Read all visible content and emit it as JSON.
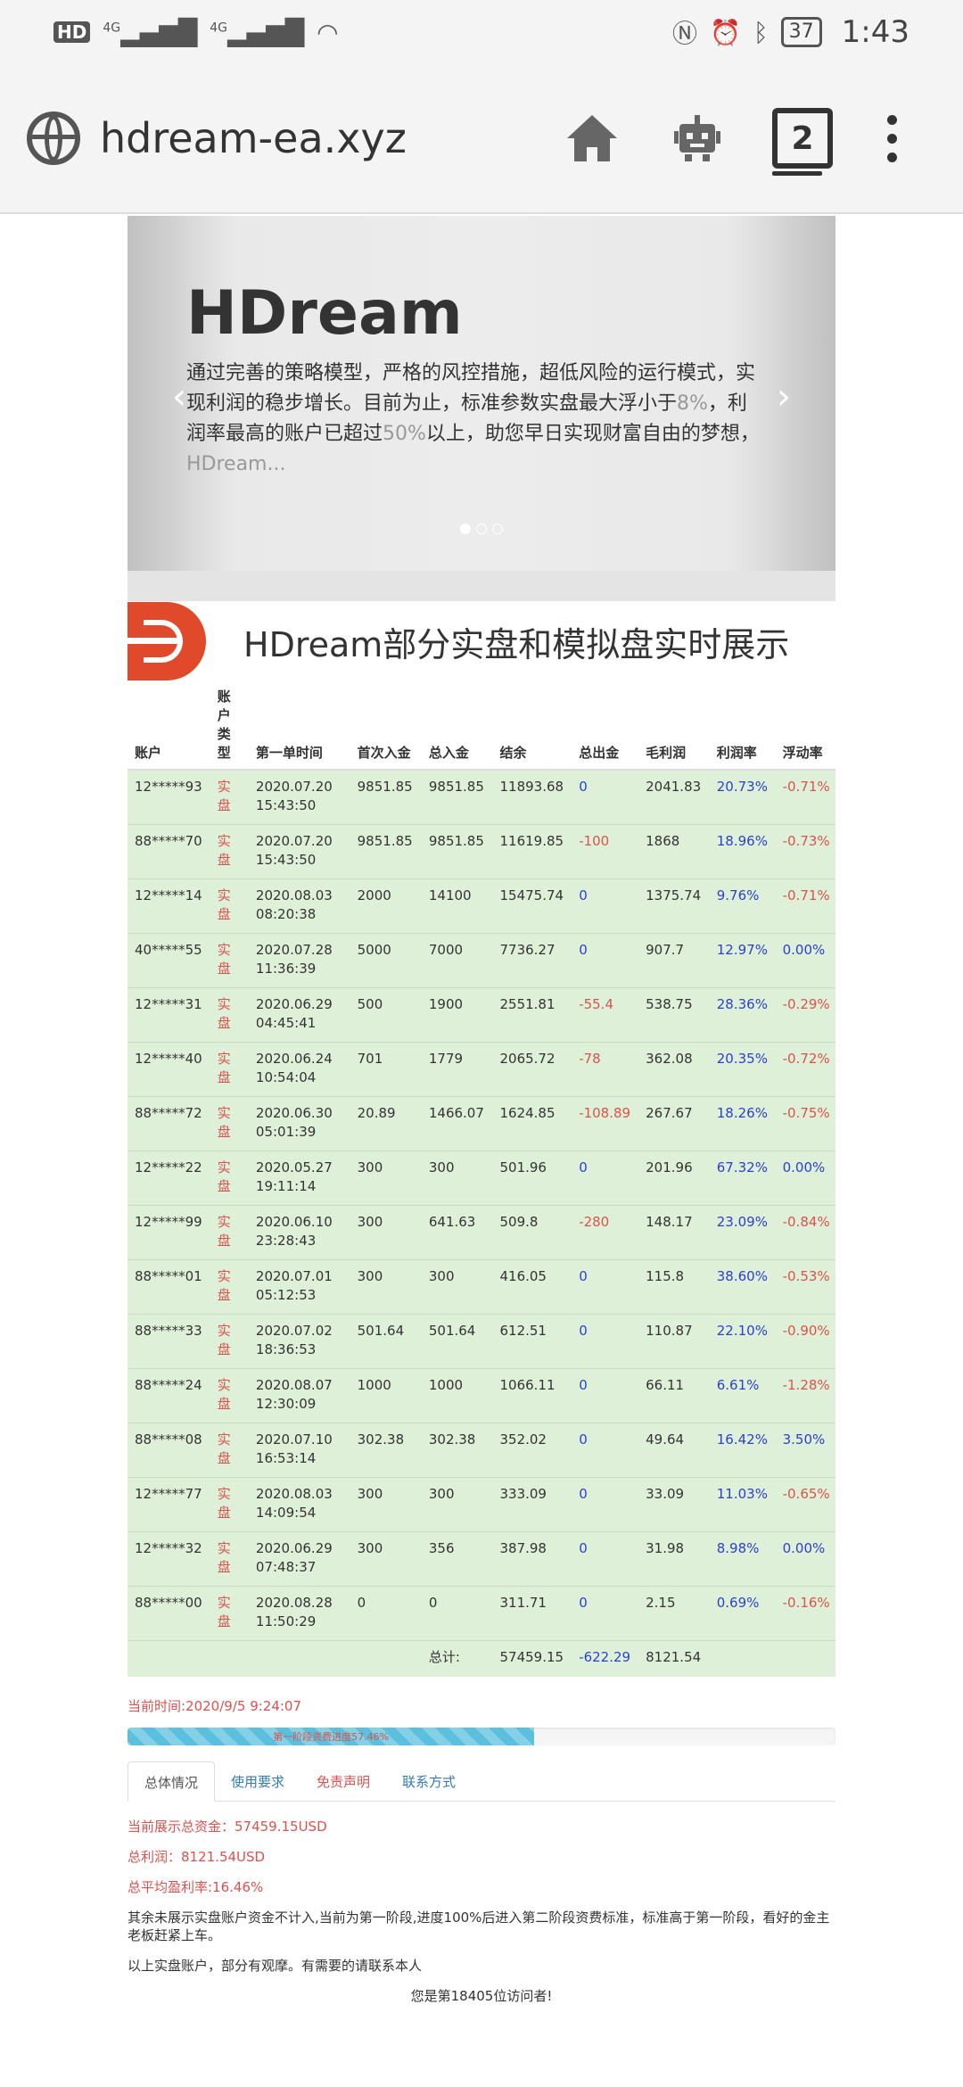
{
  "status_bar": {
    "hd": "HD",
    "net1": "4G",
    "net2": "4G",
    "battery": "37",
    "time": "1:43"
  },
  "browser": {
    "url": "hdream-ea.xyz",
    "tab_count": "2"
  },
  "carousel": {
    "title": "HDream",
    "desc_1": "通过完善的策略模型，严格的风控措施，超低风险的运行模式，实现利润的稳步增长。目前为止，标准参数实盘最大浮小于",
    "desc_hl1": "8%",
    "desc_2": "，利润率最高的账户已超过",
    "desc_hl2": "50%",
    "desc_3": "以上，助您早日实现财富自由的梦想，",
    "desc_more": "HDream...",
    "prev": "‹",
    "next": "›"
  },
  "heading": "HDream部分实盘和模拟盘实时展示",
  "table": {
    "headers": [
      "账户",
      "账户类型",
      "第一单时间",
      "首次入金",
      "总入金",
      "结余",
      "总出金",
      "毛利润",
      "利润率",
      "浮动率"
    ],
    "rows": [
      [
        "12*****93",
        "实盘",
        "2020.07.20 15:43:50",
        "9851.85",
        "9851.85",
        "11893.68",
        "0",
        "2041.83",
        "20.73%",
        "-0.71%"
      ],
      [
        "88*****70",
        "实盘",
        "2020.07.20 15:43:50",
        "9851.85",
        "9851.85",
        "11619.85",
        "-100",
        "1868",
        "18.96%",
        "-0.73%"
      ],
      [
        "12*****14",
        "实盘",
        "2020.08.03 08:20:38",
        "2000",
        "14100",
        "15475.74",
        "0",
        "1375.74",
        "9.76%",
        "-0.71%"
      ],
      [
        "40*****55",
        "实盘",
        "2020.07.28 11:36:39",
        "5000",
        "7000",
        "7736.27",
        "0",
        "907.7",
        "12.97%",
        "0.00%"
      ],
      [
        "12*****31",
        "实盘",
        "2020.06.29 04:45:41",
        "500",
        "1900",
        "2551.81",
        "-55.4",
        "538.75",
        "28.36%",
        "-0.29%"
      ],
      [
        "12*****40",
        "实盘",
        "2020.06.24 10:54:04",
        "701",
        "1779",
        "2065.72",
        "-78",
        "362.08",
        "20.35%",
        "-0.72%"
      ],
      [
        "88*****72",
        "实盘",
        "2020.06.30 05:01:39",
        "20.89",
        "1466.07",
        "1624.85",
        "-108.89",
        "267.67",
        "18.26%",
        "-0.75%"
      ],
      [
        "12*****22",
        "实盘",
        "2020.05.27 19:11:14",
        "300",
        "300",
        "501.96",
        "0",
        "201.96",
        "67.32%",
        "0.00%"
      ],
      [
        "12*****99",
        "实盘",
        "2020.06.10 23:28:43",
        "300",
        "641.63",
        "509.8",
        "-280",
        "148.17",
        "23.09%",
        "-0.84%"
      ],
      [
        "88*****01",
        "实盘",
        "2020.07.01 05:12:53",
        "300",
        "300",
        "416.05",
        "0",
        "115.8",
        "38.60%",
        "-0.53%"
      ],
      [
        "88*****33",
        "实盘",
        "2020.07.02 18:36:53",
        "501.64",
        "501.64",
        "612.51",
        "0",
        "110.87",
        "22.10%",
        "-0.90%"
      ],
      [
        "88*****24",
        "实盘",
        "2020.08.07 12:30:09",
        "1000",
        "1000",
        "1066.11",
        "0",
        "66.11",
        "6.61%",
        "-1.28%"
      ],
      [
        "88*****08",
        "实盘",
        "2020.07.10 16:53:14",
        "302.38",
        "302.38",
        "352.02",
        "0",
        "49.64",
        "16.42%",
        "3.50%"
      ],
      [
        "12*****77",
        "实盘",
        "2020.08.03 14:09:54",
        "300",
        "300",
        "333.09",
        "0",
        "33.09",
        "11.03%",
        "-0.65%"
      ],
      [
        "12*****32",
        "实盘",
        "2020.06.29 07:48:37",
        "300",
        "356",
        "387.98",
        "0",
        "31.98",
        "8.98%",
        "0.00%"
      ],
      [
        "88*****00",
        "实盘",
        "2020.08.28 11:50:29",
        "0",
        "0",
        "311.71",
        "0",
        "2.15",
        "0.69%",
        "-0.16%"
      ]
    ],
    "total_label": "总计:",
    "total_balance": "57459.15",
    "total_withdraw": "-622.29",
    "total_profit": "8121.54"
  },
  "current_time": "当前时间:2020/9/5 9:24:07",
  "progress": {
    "value": 0.5746,
    "label": "第一阶段资费进度57.46%"
  },
  "tabs": [
    "总体情况",
    "使用要求",
    "免责声明",
    "联系方式"
  ],
  "summary": {
    "total_funds": "当前展示总资金：57459.15USD",
    "total_profit": "总利润：8121.54USD",
    "avg_rate": "总平均盈利率:16.46%",
    "note1": "其余未展示实盘账户资金不计入,当前为第一阶段,进度100%后进入第二阶段资费标准，标准高于第一阶段，看好的金主老板赶紧上车。",
    "note2": "以上实盘账户，部分有观摩。有需要的请联系本人",
    "visitor": "您是第18405位访问者!"
  },
  "colors": {
    "row_bg": "#dff0d8",
    "red": "#d9534f",
    "blue": "#2c3fd0",
    "progress": "#5bc0de",
    "logo": "#e04a2a"
  }
}
